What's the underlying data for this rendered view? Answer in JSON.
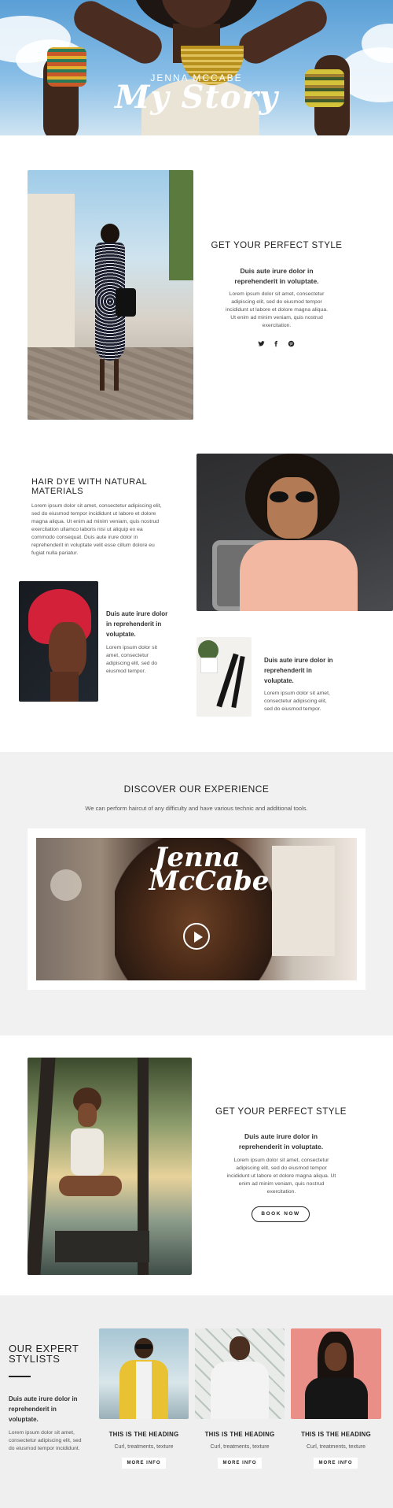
{
  "hero": {
    "subtitle": "JENNA MCCABE",
    "title": "My Story"
  },
  "section1": {
    "heading": "GET YOUR PERFECT STYLE",
    "lead": "Duis aute irure dolor in reprehenderit in voluptate.",
    "body": "Lorem ipsum dolor sit amet, consectetur adipiscing elit, sed do eiusmod tempor incididunt ut labore et dolore magna aliqua. Ut enim ad minim veniam, quis nostrud exercitation.",
    "social": [
      {
        "icon": "twitter-icon",
        "glyph": "✔"
      },
      {
        "icon": "facebook-icon",
        "glyph": "f"
      },
      {
        "icon": "pinterest-icon",
        "glyph": "℗"
      }
    ]
  },
  "section2": {
    "heading": "HAIR DYE WITH NATURAL MATERIALS",
    "body": "Lorem ipsum dolor sit amet, consectetur adipiscing elit, sed do eiusmod tempor incididunt ut labore et dolore magna aliqua. Ut enim ad minim veniam, quis nostrud exercitation ullamco laboris nisi ut aliquip ex ea commodo consequat. Duis aute irure dolor in reprehenderit in voluptate velit esse cillum dolore eu fugiat nulla pariatur.",
    "card_left": {
      "lead": "Duis aute irure dolor in reprehenderit in voluptate.",
      "body": "Lorem ipsum dolor sit amet, consectetur adipiscing elit, sed do eiusmod tempor."
    },
    "card_right": {
      "lead": "Duis aute irure dolor in reprehenderit in voluptate.",
      "body": "Lorem ipsum dolor sit amet, consectetur adipiscing elit, sed do eiusmod tempor."
    }
  },
  "discover": {
    "heading": "DISCOVER OUR EXPERIENCE",
    "subheading": "We can perform haircut of any difficulty and have various technic and additional tools.",
    "video_title_line1": "Jenna",
    "video_title_line2": "McCabe"
  },
  "section3": {
    "heading": "GET YOUR PERFECT STYLE",
    "lead": "Duis aute irure dolor in reprehenderit in voluptate.",
    "body": "Lorem ipsum dolor sit amet, consectetur adipiscing elit, sed do eiusmod tempor incididunt ut labore et dolore magna aliqua. Ut enim ad minim veniam, quis nostrud exercitation.",
    "button": "BOOK NOW"
  },
  "stylists": {
    "heading": "OUR EXPERT STYLISTS",
    "lead": "Duis aute irure dolor in reprehenderit in voluptate.",
    "body": "Lorem ipsum dolor sit amet, consectetur adipiscing elit, sed do eiusmod tempor incididunt.",
    "cards": [
      {
        "heading": "THIS IS THE HEADING",
        "sub": "Curl, treatments, texture",
        "button": "MORE INFO"
      },
      {
        "heading": "THIS IS THE HEADING",
        "sub": "Curl, treatments, texture",
        "button": "MORE INFO"
      },
      {
        "heading": "THIS IS THE HEADING",
        "sub": "Curl, treatments, texture",
        "button": "MORE INFO"
      }
    ]
  }
}
